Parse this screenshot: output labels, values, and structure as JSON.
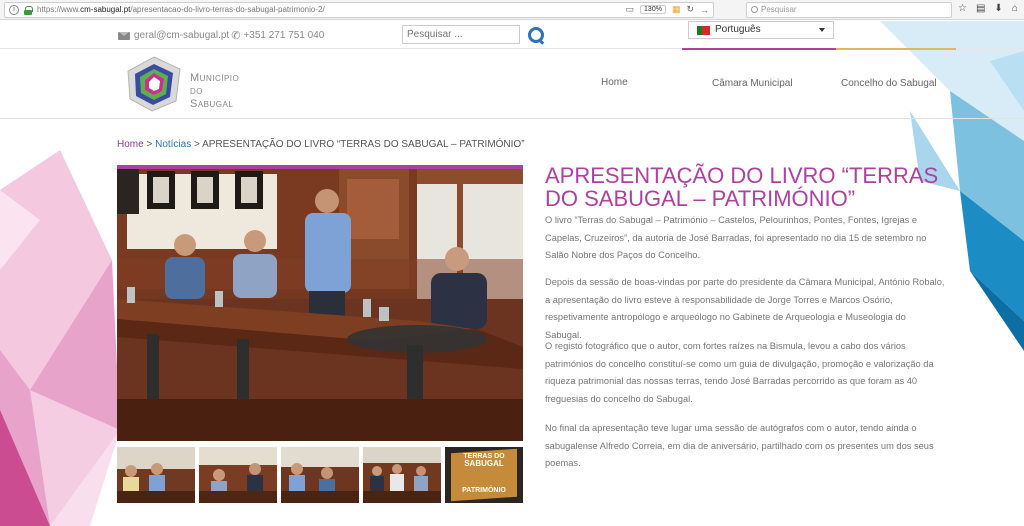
{
  "browser": {
    "url_prefix": "https://www.",
    "url_domain": "cm-sabugal.pt",
    "url_path": "/apresentacao-do-livro-terras-do-sabugal-patrimonio-2/",
    "zoom": "130%",
    "search_placeholder": "Pesquisar"
  },
  "topbar": {
    "email": "geral@cm-sabugal.pt",
    "phone": "+351 271 751 040",
    "search_placeholder": "Pesquisar ...",
    "language": "Português"
  },
  "logo": {
    "line1": "Município",
    "line2": "do",
    "line3": "Sabugal"
  },
  "nav": [
    {
      "label": "Home"
    },
    {
      "label": "Câmara Municipal"
    },
    {
      "label": "Concelho do Sabugal"
    }
  ],
  "breadcrumb": {
    "home": "Home",
    "sep1": " > ",
    "news": "Notícias",
    "sep2": " > ",
    "current": "APRESENTAÇÃO DO LIVRO “TERRAS DO SABUGAL – PATRIMÓNIO”"
  },
  "article": {
    "title": "APRESENTAÇÃO DO LIVRO “TERRAS DO SABUGAL – PATRIMÓNIO”",
    "paragraphs": [
      "O livro “Terras do Sabugal – Património – Castelos, Pelourinhos, Pontes, Fontes, Igrejas e Capelas, Cruzeiros”, da autoria de José Barradas, foi apresentado no dia 15 de setembro no Salão Nobre dos Paços do Concelho.",
      "Depois da sessão de boas-vindas por parte do presidente da Câmara Municipal, António Robalo, a apresentação do livro esteve à responsabilidade de Jorge Torres e Marcos Osório, respetivamente antropólogo e arqueólogo no Gabinete de Arqueologia e Museologia do Sabugal.",
      "O registo fotográfico que o autor, com fortes raízes na Bismula, levou a cabo dos vários patrimónios do concelho constituí-se como um guia de divulgação, promoção e valorização da riqueza patrimonial das nossas terras, tendo José Barradas percorrido as que foram as 40 freguesias do concelho do Sabugal.",
      "No final da apresentação teve lugar uma sessão de autógrafos com o autor, tendo ainda o sabugalense Alfredo Correia, em dia de aniversário, partilhado com os presentes um dos seus poemas."
    ]
  },
  "thumbnails": [
    {
      "name": "thumb-1"
    },
    {
      "name": "thumb-2"
    },
    {
      "name": "thumb-3"
    },
    {
      "name": "thumb-4"
    },
    {
      "name": "thumb-5",
      "book_title_1": "TERRAS DO",
      "book_title_2": "SABUGAL",
      "book_sub": "PATRIMÓNIO"
    }
  ]
}
